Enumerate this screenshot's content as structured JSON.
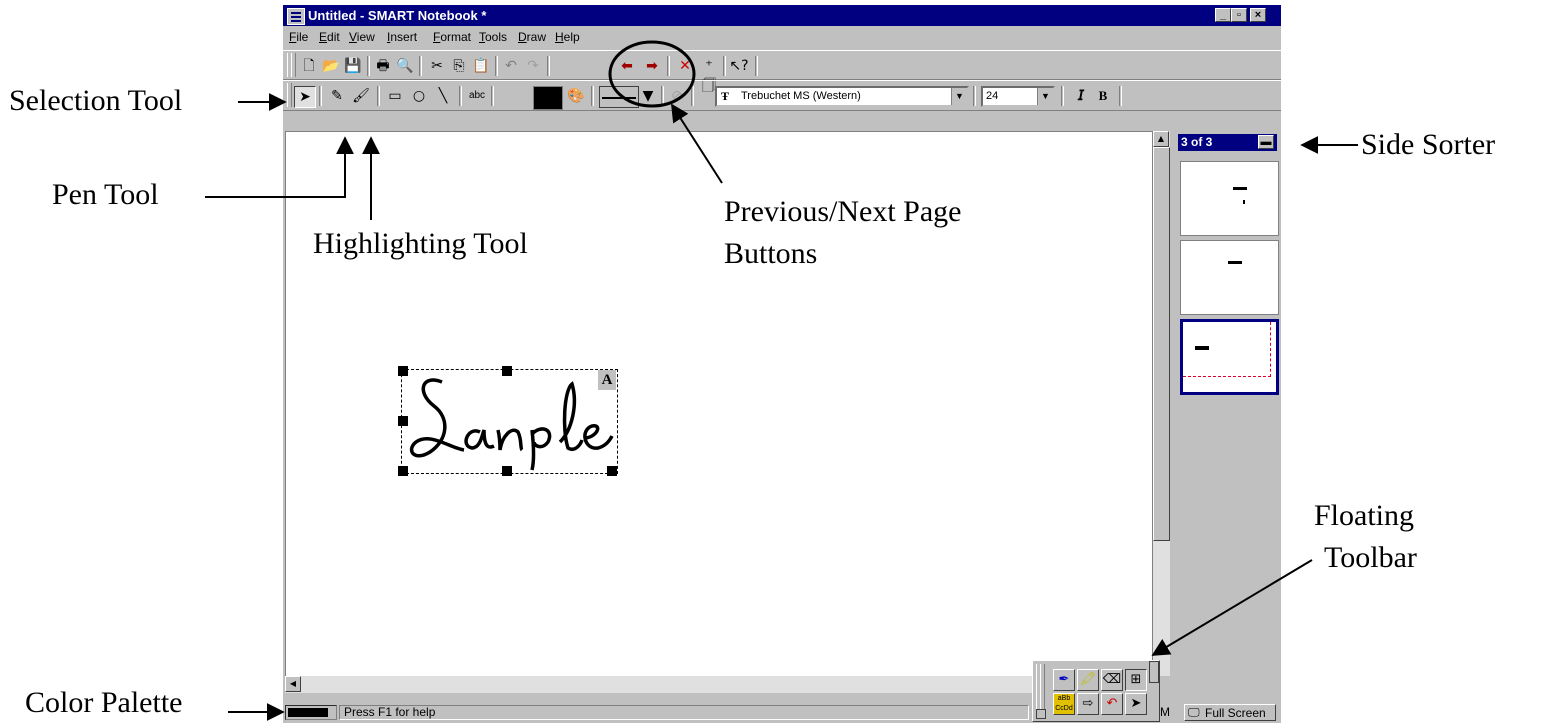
{
  "window": {
    "title": "Untitled - SMART Notebook *",
    "controls": [
      "_",
      "▫",
      "×"
    ]
  },
  "menu": [
    "File",
    "Edit",
    "View",
    "Insert",
    "Format",
    "Tools",
    "Draw",
    "Help"
  ],
  "font_combo": {
    "value": "Trebuchet MS (Western)"
  },
  "size_combo": {
    "value": "24"
  },
  "toolbar_text": {
    "abc": "abc",
    "bold": "B"
  },
  "canvas_text": {
    "object_badge": "A",
    "handwriting": "Sanple"
  },
  "sorter": {
    "header": "3 of 3",
    "current_page": 3,
    "page_count": 3
  },
  "status": {
    "color_label": "",
    "help": "Press F1 for help",
    "clock_partial": "M",
    "fullscreen": "Full Screen"
  },
  "floating": {
    "text_icon": "aBb CcDd"
  },
  "annotations": {
    "selection": "Selection Tool",
    "pen": "Pen Tool",
    "highlight": "Highlighting Tool",
    "prevnext_line1": "Previous/Next Page",
    "prevnext_line2": "Buttons",
    "sorter": "Side Sorter",
    "floating_line1": "Floating",
    "floating_line2": "Toolbar",
    "palette": "Color Palette"
  }
}
